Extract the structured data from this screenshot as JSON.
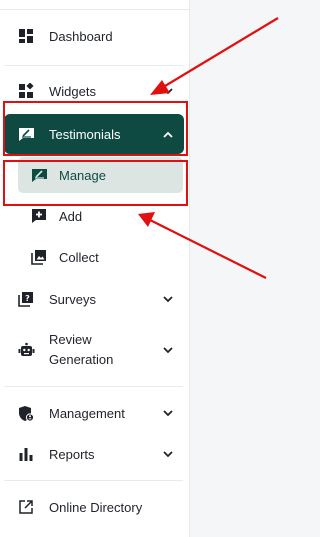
{
  "sidebar": {
    "items": [
      {
        "label": "Dashboard",
        "icon": "dashboard-icon"
      },
      {
        "label": "Widgets",
        "icon": "widgets-icon"
      },
      {
        "label": "Testimonials",
        "icon": "testimonials-icon",
        "active": true
      },
      {
        "label": "Surveys",
        "icon": "surveys-icon"
      },
      {
        "label": "Review Generation",
        "line1": "Review",
        "line2": "Generation",
        "icon": "robot-icon"
      },
      {
        "label": "Management",
        "icon": "shield-icon"
      },
      {
        "label": "Reports",
        "icon": "bar-chart-icon"
      },
      {
        "label": "Online Directory",
        "icon": "external-link-icon"
      }
    ],
    "testimonials_sub": [
      {
        "label": "Manage",
        "icon": "edit-icon",
        "selected": true
      },
      {
        "label": "Add",
        "icon": "add-icon"
      },
      {
        "label": "Collect",
        "icon": "image-gallery-icon"
      }
    ]
  },
  "colors": {
    "accent": "#0e4a42",
    "submenu_selected_bg": "#dde5e3",
    "annotation": "#e01010"
  }
}
